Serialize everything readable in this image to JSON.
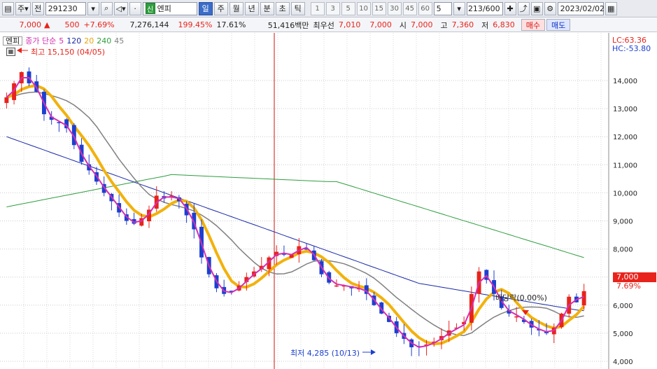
{
  "toolbar": {
    "market_label": "주",
    "jeon_label": "전",
    "code_value": "291230",
    "sin_badge": "신",
    "name_value": "엔피",
    "periods": [
      "일",
      "주",
      "월",
      "년",
      "분",
      "초",
      "틱"
    ],
    "active_period": "일",
    "minute_options": [
      "1",
      "3",
      "5",
      "10",
      "15",
      "30",
      "45",
      "60"
    ],
    "count_select": "5",
    "bar_count": "213",
    "bar_total": "/600",
    "date_value": "2023/02/02"
  },
  "quote": {
    "price": "7,000",
    "arrow": "▲",
    "change": "500",
    "change_pct": "+7.69%",
    "volume": "7,276,144",
    "volume_ratio": "199.45%",
    "turnover": "17.61%",
    "amount": "51,416백만",
    "best_label": "최우선",
    "best_ask": "7,010",
    "best_bid": "7,000",
    "open_label": "시",
    "open": "7,000",
    "high_label": "고",
    "high": "7,360",
    "low_label": "저",
    "low": "6,830",
    "buy_label": "매수",
    "sell_label": "매도"
  },
  "legend": {
    "name": "엔피",
    "indicator": "종가 단순",
    "ma5": "5",
    "ma120": "120",
    "ma20": "20",
    "ma240": "240",
    "ma45": "45"
  },
  "annotations": {
    "high": "최고 15,150 (04/05)",
    "low": "최저 4,285 (10/13)",
    "dividend": "배당락(0.00%)",
    "lc": "LC:63.36",
    "hc": "HC:-53.80",
    "current_price": "7,000",
    "current_pct": "7.69%"
  },
  "colors": {
    "up": "#e8231b",
    "down": "#1c3fd0",
    "ma5": "#d42fb2",
    "ma20": "#f2b20c",
    "ma45": "#808080",
    "ma120": "#1a2aa8",
    "ma240": "#2f9e3e"
  },
  "chart_data": {
    "type": "candlestick",
    "y_ticks": [
      "4,000",
      "5,000",
      "6,000",
      "7,000",
      "8,000",
      "9,000",
      "10,000",
      "11,000",
      "12,000",
      "13,000",
      "14,000"
    ],
    "ylim": [
      4000,
      15200
    ],
    "close_series": [
      13400,
      13900,
      14300,
      13900,
      13600,
      12800,
      12600,
      12500,
      12300,
      11700,
      11100,
      10800,
      10400,
      10000,
      9700,
      9300,
      9000,
      8900,
      9100,
      9400,
      9900,
      9800,
      9900,
      9700,
      9200,
      8700,
      7700,
      7100,
      6600,
      6400,
      6500,
      6700,
      7000,
      7200,
      7400,
      7700,
      7900,
      7800,
      7800,
      8100,
      8000,
      7600,
      7100,
      6800,
      6700,
      6700,
      6600,
      6600,
      6400,
      6000,
      5700,
      5400,
      5000,
      4800,
      4500,
      4500,
      4600,
      4700,
      4900,
      5100,
      5200,
      5400,
      6400,
      7200,
      6900,
      6400,
      5900,
      5700,
      5600,
      5400,
      5200,
      5100,
      5000,
      5200,
      5700,
      6300,
      6100,
      6500
    ]
  }
}
